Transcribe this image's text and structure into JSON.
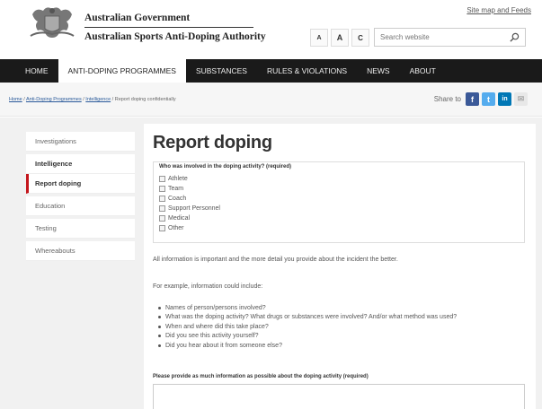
{
  "header": {
    "gov_title": "Australian Government",
    "agency_title": "Australian Sports Anti-Doping Authority",
    "sitemap_label": "Site map and Feeds",
    "font_buttons": [
      "A",
      "A",
      "C"
    ],
    "search_placeholder": "Search website"
  },
  "nav": {
    "items": [
      {
        "label": "HOME",
        "active": false
      },
      {
        "label": "ANTI-DOPING PROGRAMMES",
        "active": true
      },
      {
        "label": "SUBSTANCES",
        "active": false
      },
      {
        "label": "RULES & VIOLATIONS",
        "active": false
      },
      {
        "label": "NEWS",
        "active": false
      },
      {
        "label": "ABOUT",
        "active": false
      }
    ]
  },
  "breadcrumb": {
    "links": [
      "Home",
      "Anti-Doping Programmes",
      "Intelligence"
    ],
    "separator": " / ",
    "current": "Report doping confidentially"
  },
  "share": {
    "label": "Share to",
    "icons": [
      {
        "name": "facebook-icon",
        "glyph": "f",
        "color": "#3b5998"
      },
      {
        "name": "twitter-icon",
        "glyph": "t",
        "color": "#55acee"
      },
      {
        "name": "linkedin-icon",
        "glyph": "in",
        "color": "#0077b5"
      },
      {
        "name": "email-icon",
        "glyph": "✉",
        "color": "#bbbbbb"
      }
    ]
  },
  "sidebar": {
    "items": [
      {
        "label": "Investigations",
        "style": "normal"
      },
      {
        "label": "Intelligence",
        "style": "bold"
      },
      {
        "label": "Report doping",
        "style": "current"
      },
      {
        "label": "Education",
        "style": "normal"
      },
      {
        "label": "Testing",
        "style": "normal"
      },
      {
        "label": "Whereabouts",
        "style": "normal"
      }
    ]
  },
  "main": {
    "title": "Report doping",
    "question": "Who was involved in the doping activity? (required)",
    "options": [
      "Athlete",
      "Team",
      "Coach",
      "Support Personnel",
      "Medical",
      "Other"
    ],
    "intro": "All information is important and the more detail you provide about the incident the better.",
    "example_lead": "For example, information could include:",
    "bullets": [
      "Names of person/persons involved?",
      "What was the doping activity? What drugs or substances were involved? And/or what method was used?",
      "When and where did this take place?",
      "Did you see this activity yourself?",
      "Did you hear about it from someone else?"
    ],
    "textarea_label": "Please provide as much information as possible about the doping activity (required)"
  },
  "colors": {
    "nav_bg": "#1a1a1a",
    "accent_red": "#c4161c",
    "link_blue": "#2a5a9a"
  }
}
